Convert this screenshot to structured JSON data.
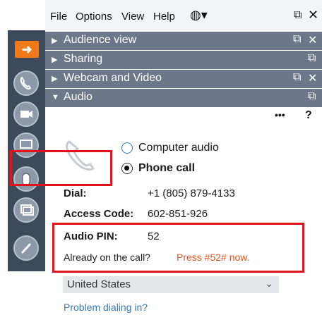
{
  "menu": {
    "file": "File",
    "options": "Options",
    "view": "View",
    "help": "Help",
    "globe_icon": "globe-icon"
  },
  "panels": [
    {
      "label": "Audience view"
    },
    {
      "label": "Sharing"
    },
    {
      "label": "Webcam and Video"
    },
    {
      "label": "Audio"
    }
  ],
  "audio": {
    "more_label": "•••",
    "help_label": "?",
    "options": [
      {
        "label": "Computer audio",
        "selected": false
      },
      {
        "label": "Phone call",
        "selected": true
      }
    ],
    "dial_label": "Dial:",
    "dial_value": "+1 (805) 879-4133",
    "access_label": "Access Code:",
    "access_value": "602-851-926",
    "pin_label": "Audio PIN:",
    "pin_value": "52",
    "already_text": "Already on the call?",
    "press_text": "Press #52# now.",
    "country": "United States",
    "problem_link": "Problem dialing in?"
  },
  "colors": {
    "accent_orange": "#f07a1a",
    "panel_header": "#6c7789",
    "toolbar": "#3d4a5c",
    "highlight_red": "#e0141a",
    "link_blue": "#3479b7"
  }
}
